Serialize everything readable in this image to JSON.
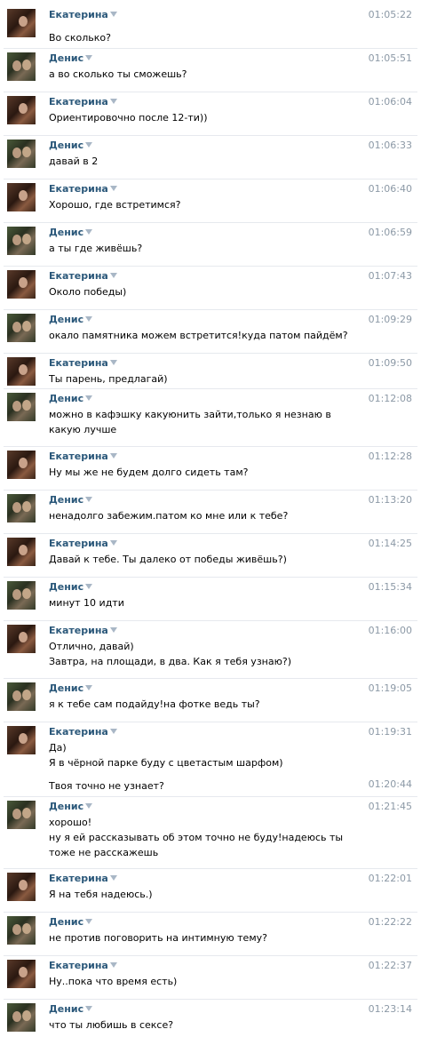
{
  "messages": [
    {
      "author": "Екатерина",
      "time": "01:05:22",
      "lines": [
        "Во сколько?"
      ]
    },
    {
      "author": "Денис",
      "time": "01:05:51",
      "lines": [
        "а во сколько ты сможешь?"
      ]
    },
    {
      "author": "Екатерина",
      "time": "01:06:04",
      "lines": [
        "Ориентировочно после 12-ти))"
      ]
    },
    {
      "author": "Денис",
      "time": "01:06:33",
      "lines": [
        "давай в 2"
      ]
    },
    {
      "author": "Екатерина",
      "time": "01:06:40",
      "lines": [
        "Хорошо, где встретимся?"
      ]
    },
    {
      "author": "Денис",
      "time": "01:06:59",
      "lines": [
        "а ты где живёшь?"
      ]
    },
    {
      "author": "Екатерина",
      "time": "01:07:43",
      "lines": [
        "Около победы)"
      ]
    },
    {
      "author": "Денис",
      "time": "01:09:29",
      "lines": [
        "окало памятника можем встретится!куда патом пайдём?"
      ]
    },
    {
      "author": "Екатерина",
      "time": "01:09:50",
      "lines": [
        "Ты парень, предлагай)"
      ]
    },
    {
      "author": "Денис",
      "time": "01:12:08",
      "lines": [
        "можно в кафэшку какуюнить зайти,только я незнаю в какую лучше"
      ]
    },
    {
      "author": "Екатерина",
      "time": "01:12:28",
      "lines": [
        "Ну мы же не будем долго сидеть там?"
      ]
    },
    {
      "author": "Денис",
      "time": "01:13:20",
      "lines": [
        "ненадолго забежим.патом ко мне или к тебе?"
      ]
    },
    {
      "author": "Екатерина",
      "time": "01:14:25",
      "lines": [
        "Давай к тебе. Ты далеко от победы живёшь?)"
      ]
    },
    {
      "author": "Денис",
      "time": "01:15:34",
      "lines": [
        "минут 10 идти"
      ]
    },
    {
      "author": "Екатерина",
      "time": "01:16:00",
      "lines": [
        "Отлично, давай)",
        "Завтра, на площади, в два. Как я тебя узнаю?)"
      ]
    },
    {
      "author": "Денис",
      "time": "01:19:05",
      "lines": [
        "я к тебе сам подайду!на фотке ведь ты?"
      ]
    },
    {
      "author": "Екатерина",
      "time": "01:19:31",
      "lines": [
        "Да)",
        "Я в чёрной парке буду с цветастым шарфом)"
      ]
    },
    {
      "author": "",
      "time": "01:20:44",
      "lines": [
        "Твоя точно не узнает?"
      ]
    },
    {
      "author": "Денис",
      "time": "01:21:45",
      "lines": [
        "хорошо!",
        "ну я ей рассказывать об этом точно не буду!надеюсь ты тоже не расскажешь"
      ]
    },
    {
      "author": "Екатерина",
      "time": "01:22:01",
      "lines": [
        "Я на тебя надеюсь.)"
      ]
    },
    {
      "author": "Денис",
      "time": "01:22:22",
      "lines": [
        "не против поговорить на интимную тему?"
      ]
    },
    {
      "author": "Екатерина",
      "time": "01:22:37",
      "lines": [
        "Ну..пока что время есть)"
      ]
    },
    {
      "author": "Денис",
      "time": "01:23:14",
      "lines": [
        "что ты любишь в сексе?"
      ]
    }
  ]
}
